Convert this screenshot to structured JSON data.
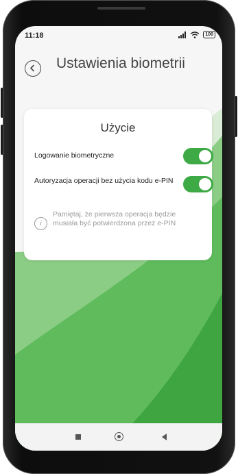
{
  "status_bar": {
    "time": "11:18",
    "battery": "100"
  },
  "header": {
    "title": "Ustawienia biometrii",
    "back_icon": "chevron-left-icon"
  },
  "card": {
    "title": "Użycie",
    "settings": [
      {
        "label": "Logowanie biometryczne",
        "enabled": true
      },
      {
        "label": "Autoryzacja operacji bez użycia kodu e-PIN",
        "enabled": true
      }
    ],
    "info_icon": "info-icon",
    "info_text": "Pamiętaj, że pierwsza operacja będzie musiała być potwierdzona przez e-PIN"
  },
  "nav_bar": {
    "items": [
      "recent-apps-icon",
      "home-icon",
      "back-icon"
    ]
  },
  "colors": {
    "accent": "#3daa46",
    "background_green": "#6ec46a",
    "text_primary": "#222222",
    "text_muted": "#999999"
  }
}
